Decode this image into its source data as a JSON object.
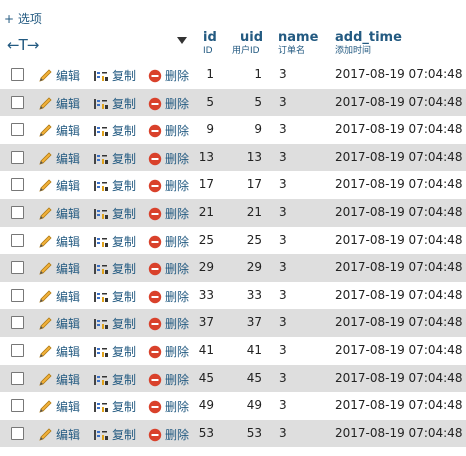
{
  "toolbar": {
    "options_label": "+ 选项"
  },
  "columns": [
    {
      "name": "id",
      "comment": "ID"
    },
    {
      "name": "uid",
      "comment": "用户ID"
    },
    {
      "name": "name",
      "comment": "订单名"
    },
    {
      "name": "add_time",
      "comment": "添加时间"
    }
  ],
  "actions": {
    "edit": "编辑",
    "copy": "复制",
    "delete": "删除"
  },
  "rows": [
    {
      "id": "1",
      "uid": "1",
      "name": "3",
      "add_time": "2017-08-19 07:04:48"
    },
    {
      "id": "5",
      "uid": "5",
      "name": "3",
      "add_time": "2017-08-19 07:04:48"
    },
    {
      "id": "9",
      "uid": "9",
      "name": "3",
      "add_time": "2017-08-19 07:04:48"
    },
    {
      "id": "13",
      "uid": "13",
      "name": "3",
      "add_time": "2017-08-19 07:04:48"
    },
    {
      "id": "17",
      "uid": "17",
      "name": "3",
      "add_time": "2017-08-19 07:04:48"
    },
    {
      "id": "21",
      "uid": "21",
      "name": "3",
      "add_time": "2017-08-19 07:04:48"
    },
    {
      "id": "25",
      "uid": "25",
      "name": "3",
      "add_time": "2017-08-19 07:04:48"
    },
    {
      "id": "29",
      "uid": "29",
      "name": "3",
      "add_time": "2017-08-19 07:04:48"
    },
    {
      "id": "33",
      "uid": "33",
      "name": "3",
      "add_time": "2017-08-19 07:04:48"
    },
    {
      "id": "37",
      "uid": "37",
      "name": "3",
      "add_time": "2017-08-19 07:04:48"
    },
    {
      "id": "41",
      "uid": "41",
      "name": "3",
      "add_time": "2017-08-19 07:04:48"
    },
    {
      "id": "45",
      "uid": "45",
      "name": "3",
      "add_time": "2017-08-19 07:04:48"
    },
    {
      "id": "49",
      "uid": "49",
      "name": "3",
      "add_time": "2017-08-19 07:04:48"
    },
    {
      "id": "53",
      "uid": "53",
      "name": "3",
      "add_time": "2017-08-19 07:04:48"
    }
  ],
  "icons": {
    "edit": "pencil-icon",
    "copy": "copy-icon",
    "delete": "delete-icon",
    "sort": "sort-desc-icon",
    "arrows": "column-arrows-icon"
  },
  "colors": {
    "link": "#235a81",
    "row_alt": "#dedede",
    "delete_red": "#d9412b"
  }
}
